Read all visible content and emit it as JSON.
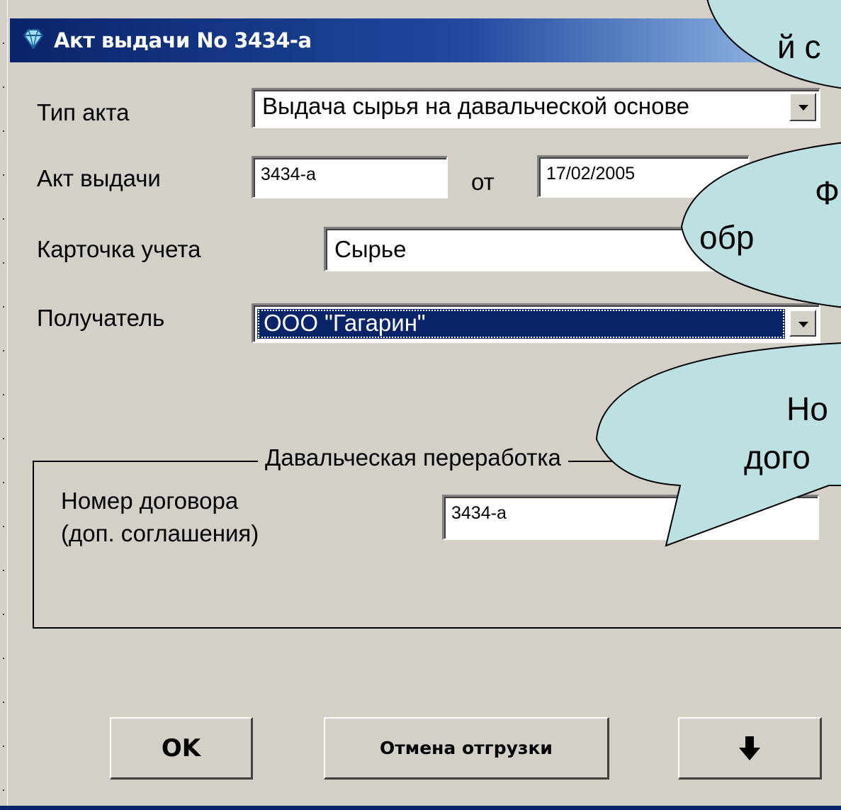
{
  "window": {
    "title": "Акт выдачи No 3434-а",
    "icon": "diamond-icon"
  },
  "form": {
    "act_type": {
      "label": "Тип акта",
      "value": "Выдача сырья на давальческой основе"
    },
    "act_number": {
      "label": "Акт выдачи",
      "value": "3434-а",
      "date_label": "от",
      "date_value": "17/02/2005"
    },
    "card": {
      "label": "Карточка учета",
      "value": "Сырье"
    },
    "recipient": {
      "label": "Получатель",
      "value": "ООО \"Гагарин\""
    }
  },
  "group": {
    "legend": "Давальческая переработка",
    "contract_label_line1": "Номер договора",
    "contract_label_line2": "(доп. соглашения)",
    "contract_value": "3434-а"
  },
  "buttons": {
    "ok": "OK",
    "cancel_shipment": "Отмена отгрузки",
    "down_arrow": "down-arrow-icon"
  },
  "callouts": {
    "top": "й с",
    "middle_line1": "Ф",
    "middle_line2": "обр",
    "bottom_line1": "Но",
    "bottom_line2": "дого"
  },
  "colors": {
    "titlebar": "#0a246a",
    "selection": "#0a246a",
    "callout_fill": "#bde0e2",
    "window_bg": "#d4d0c8"
  }
}
